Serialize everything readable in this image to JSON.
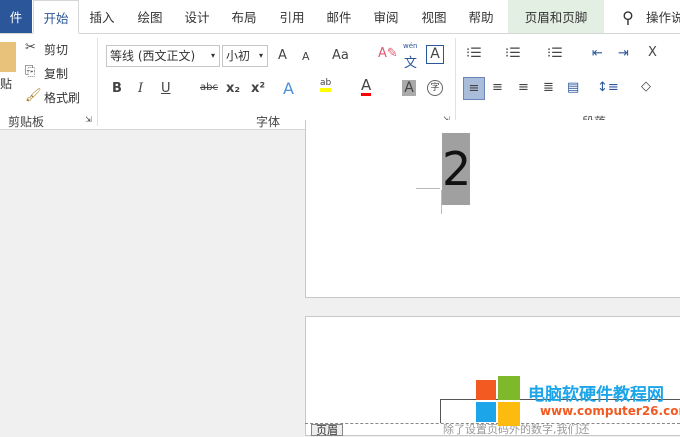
{
  "tabs": [
    "件",
    "开始",
    "插入",
    "绘图",
    "设计",
    "布局",
    "引用",
    "邮件",
    "审阅",
    "视图",
    "帮助",
    "页眉和页脚",
    "操作说"
  ],
  "clipboard": {
    "paste": "贴",
    "cut": "剪切",
    "copy": "复制",
    "format_painter": "格式刷",
    "group": "剪贴板"
  },
  "font": {
    "name": "等线 (西文正文)",
    "size": "小初",
    "group": "字体",
    "bold": "B",
    "italic": "I",
    "underline": "U",
    "strike": "abc",
    "sub": "x₂",
    "sup": "x²",
    "grow": "A",
    "shrink": "A",
    "case": "Aa",
    "phonetic_top": "wén",
    "phonetic": "文",
    "border_a": "A",
    "effects": "A",
    "highlight": "ab",
    "color": "A",
    "shade": "A",
    "enclose": "字"
  },
  "paragraph": {
    "group": "段落"
  },
  "document": {
    "page_number": "2",
    "header_tab": "页眉",
    "body_text": "除了设置页码外的数字,我们还"
  },
  "watermark": {
    "title": "电脑软硬件教程网",
    "url": "www.computer26.com"
  },
  "colors": {
    "file_tab": "#2b579a",
    "context_tab": "#e3efe3",
    "highlight": "#ffff00",
    "font_color": "#ff0000"
  }
}
